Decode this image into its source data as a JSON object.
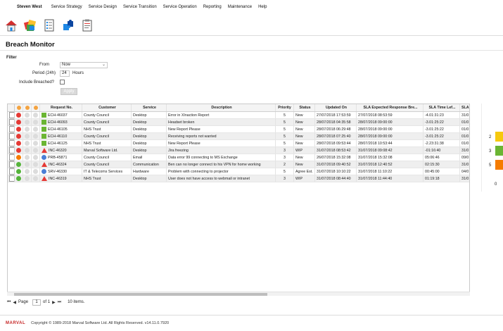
{
  "menu": {
    "user": "Steven West",
    "items": [
      "Service Strategy",
      "Service Design",
      "Service Transition",
      "Service Operation",
      "Reporting",
      "Maintenance",
      "Help"
    ]
  },
  "toolbar": {
    "icons": [
      "home-icon",
      "colour-palette-icon",
      "checklist-icon",
      "puzzle-icon",
      "clipboard-icon"
    ]
  },
  "page": {
    "title": "Breach Monitor"
  },
  "filter": {
    "title": "Filter",
    "from_label": "From",
    "from_value": "Now",
    "period_label": "Period (24h)",
    "period_value": "24",
    "hours_label": "Hours",
    "include_label": "Include Breached?",
    "apply_label": "Apply"
  },
  "grid": {
    "headers": {
      "request": "Request No.",
      "customer": "Customer",
      "service": "Service",
      "description": "Description",
      "priority": "Priority",
      "status": "Status",
      "updated": "Updated On",
      "sla_resp": "SLA Expected Response Bre...",
      "sla_time": "SLA Time Lef...",
      "sla_e": "SLA E"
    },
    "rows": [
      {
        "s1": "red",
        "s2": "grey",
        "s3": "grey",
        "type": "sq",
        "request": "ECH-46037",
        "customer": "County Council",
        "service": "Desktop",
        "description": "Error in XInaction Report",
        "priority": "5",
        "status": "New",
        "updated": "27/07/2018 17:53:59",
        "sla_resp": "27/07/2018 08:53:59",
        "sla_time": "-4.01:31:23",
        "sla_e": "31/0"
      },
      {
        "s1": "red",
        "s2": "grey",
        "s3": "grey",
        "type": "sq",
        "request": "ECH-46093",
        "customer": "County Council",
        "service": "Desktop",
        "description": "Headset broken",
        "priority": "5",
        "status": "New",
        "updated": "28/07/2018 04:35:58",
        "sla_resp": "28/07/2018 09:00:00",
        "sla_time": "-3.01:25:22",
        "sla_e": "01/0"
      },
      {
        "s1": "red",
        "s2": "grey",
        "s3": "grey",
        "type": "sq",
        "request": "ECH-46105",
        "customer": "NHS Trust",
        "service": "Desktop",
        "description": "New Report Please",
        "priority": "5",
        "status": "New",
        "updated": "28/07/2018 06:29:48",
        "sla_resp": "28/07/2018 09:00:00",
        "sla_time": "-3.01:25:22",
        "sla_e": "01/0"
      },
      {
        "s1": "red",
        "s2": "grey",
        "s3": "grey",
        "type": "sq",
        "request": "ECH-46110",
        "customer": "County Council",
        "service": "Desktop",
        "description": "Receiving reports not wanted",
        "priority": "5",
        "status": "New",
        "updated": "28/07/2018 07:25:40",
        "sla_resp": "28/07/2018 09:00:00",
        "sla_time": "-3.01:25:22",
        "sla_e": "01/0"
      },
      {
        "s1": "red",
        "s2": "grey",
        "s3": "grey",
        "type": "sq",
        "request": "ECH-46125",
        "customer": "NHS Trust",
        "service": "Desktop",
        "description": "New Report Please",
        "priority": "5",
        "status": "New",
        "updated": "28/07/2018 09:53:44",
        "sla_resp": "28/07/2018 10:53:44",
        "sla_time": "-2.23:31:38",
        "sla_e": "01/0"
      },
      {
        "s1": "red",
        "s2": "grey",
        "s3": "grey",
        "type": "tri",
        "request": "INC-46320",
        "customer": "Marval Software Ltd.",
        "service": "Desktop",
        "description": "Jira freezing",
        "priority": "3",
        "status": "WIP",
        "updated": "31/07/2018 08:53:42",
        "sla_resp": "31/07/2018 09:08:42",
        "sla_time": "-01:16:40",
        "sla_e": "31/0"
      },
      {
        "s1": "orange",
        "s2": "grey",
        "s3": "grey",
        "type": "circ",
        "request": "PRB-45871",
        "customer": "County Council",
        "service": "Email",
        "description": "Data error 99 connecting to MS Exchange",
        "priority": "3",
        "status": "New",
        "updated": "26/07/2018 15:32:08",
        "sla_resp": "31/07/2018 15:32:08",
        "sla_time": "05:06:46",
        "sla_e": "09/0"
      },
      {
        "s1": "green",
        "s2": "grey",
        "s3": "grey",
        "type": "tri",
        "request": "INC-46324",
        "customer": "County Council",
        "service": "Communication",
        "description": "Ben can no longer connect to his VPN for home working",
        "priority": "2",
        "status": "New",
        "updated": "31/07/2018 09:40:52",
        "sla_resp": "31/07/2018 12:40:52",
        "sla_time": "02:15:30",
        "sla_e": "31/0"
      },
      {
        "s1": "green",
        "s2": "grey",
        "s3": "grey",
        "type": "circ",
        "request": "SRV-46330",
        "customer": "IT & Telecoms Services",
        "service": "Hardware",
        "description": "Problem with connecting to projector",
        "priority": "5",
        "status": "Agree Est.",
        "updated": "31/07/2018 10:10:22",
        "sla_resp": "31/07/2018 11:10:22",
        "sla_time": "00:45:00",
        "sla_e": "04/0"
      },
      {
        "s1": "green",
        "s2": "grey",
        "s3": "grey",
        "type": "tri",
        "request": "INC-46319",
        "customer": "NHS Trust",
        "service": "Desktop",
        "description": "User does not have access to webmail or intranet",
        "priority": "3",
        "status": "WIP",
        "updated": "31/07/2018 08:44:40",
        "sla_resp": "31/07/2018 11:44:40",
        "sla_time": "01:19:18",
        "sla_e": "31/0"
      }
    ]
  },
  "pager": {
    "page_label": "Page",
    "page_value": "1",
    "of_label": "of 1",
    "items_label": "10 items."
  },
  "sidechart": {
    "labels": [
      "2",
      "3",
      "5",
      "0"
    ],
    "colors": [
      "#f6c90e",
      "#6bb533",
      "#f57c00"
    ]
  },
  "footer": {
    "logo": "MARVAL",
    "copyright": "Copyright © 1989-2018 Marval Software Ltd. All Rights Reserved. v14.11.0.7920"
  }
}
